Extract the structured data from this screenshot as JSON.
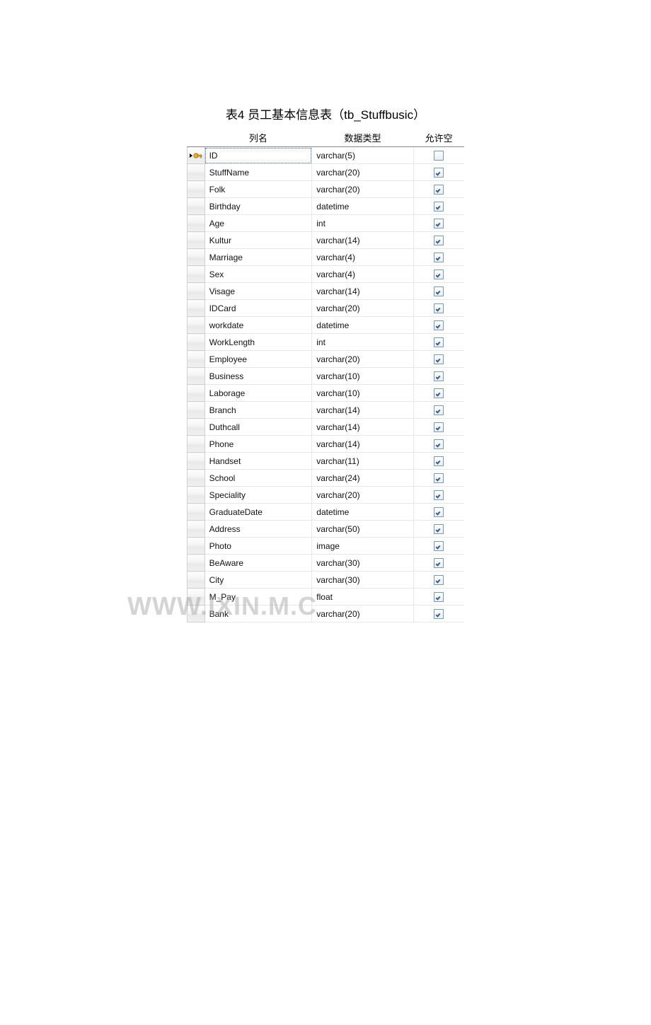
{
  "caption": "表4 员工基本信息表（tb_Stuffbusic）",
  "headers": {
    "name": "列名",
    "type": "数据类型",
    "allow_null": "允许空"
  },
  "rows": [
    {
      "name": "ID",
      "type": "varchar(5)",
      "allow_null": false,
      "pk": true
    },
    {
      "name": "StuffName",
      "type": "varchar(20)",
      "allow_null": true,
      "pk": false
    },
    {
      "name": "Folk",
      "type": "varchar(20)",
      "allow_null": true,
      "pk": false
    },
    {
      "name": "Birthday",
      "type": "datetime",
      "allow_null": true,
      "pk": false
    },
    {
      "name": "Age",
      "type": "int",
      "allow_null": true,
      "pk": false
    },
    {
      "name": "Kultur",
      "type": "varchar(14)",
      "allow_null": true,
      "pk": false
    },
    {
      "name": "Marriage",
      "type": "varchar(4)",
      "allow_null": true,
      "pk": false
    },
    {
      "name": "Sex",
      "type": "varchar(4)",
      "allow_null": true,
      "pk": false
    },
    {
      "name": "Visage",
      "type": "varchar(14)",
      "allow_null": true,
      "pk": false
    },
    {
      "name": "IDCard",
      "type": "varchar(20)",
      "allow_null": true,
      "pk": false
    },
    {
      "name": "workdate",
      "type": "datetime",
      "allow_null": true,
      "pk": false
    },
    {
      "name": "WorkLength",
      "type": "int",
      "allow_null": true,
      "pk": false
    },
    {
      "name": "Employee",
      "type": "varchar(20)",
      "allow_null": true,
      "pk": false
    },
    {
      "name": "Business",
      "type": "varchar(10)",
      "allow_null": true,
      "pk": false
    },
    {
      "name": "Laborage",
      "type": "varchar(10)",
      "allow_null": true,
      "pk": false
    },
    {
      "name": "Branch",
      "type": "varchar(14)",
      "allow_null": true,
      "pk": false
    },
    {
      "name": "Duthcall",
      "type": "varchar(14)",
      "allow_null": true,
      "pk": false
    },
    {
      "name": "Phone",
      "type": "varchar(14)",
      "allow_null": true,
      "pk": false
    },
    {
      "name": "Handset",
      "type": "varchar(11)",
      "allow_null": true,
      "pk": false
    },
    {
      "name": "School",
      "type": "varchar(24)",
      "allow_null": true,
      "pk": false
    },
    {
      "name": "Speciality",
      "type": "varchar(20)",
      "allow_null": true,
      "pk": false
    },
    {
      "name": "GraduateDate",
      "type": "datetime",
      "allow_null": true,
      "pk": false
    },
    {
      "name": "Address",
      "type": "varchar(50)",
      "allow_null": true,
      "pk": false
    },
    {
      "name": "Photo",
      "type": "image",
      "allow_null": true,
      "pk": false
    },
    {
      "name": "BeAware",
      "type": "varchar(30)",
      "allow_null": true,
      "pk": false
    },
    {
      "name": "City",
      "type": "varchar(30)",
      "allow_null": true,
      "pk": false
    },
    {
      "name": "M_Pay",
      "type": "float",
      "allow_null": true,
      "pk": false
    },
    {
      "name": "Bank",
      "type": "varchar(20)",
      "allow_null": true,
      "pk": false
    }
  ],
  "watermark": "WWW.IXIN.M.C"
}
